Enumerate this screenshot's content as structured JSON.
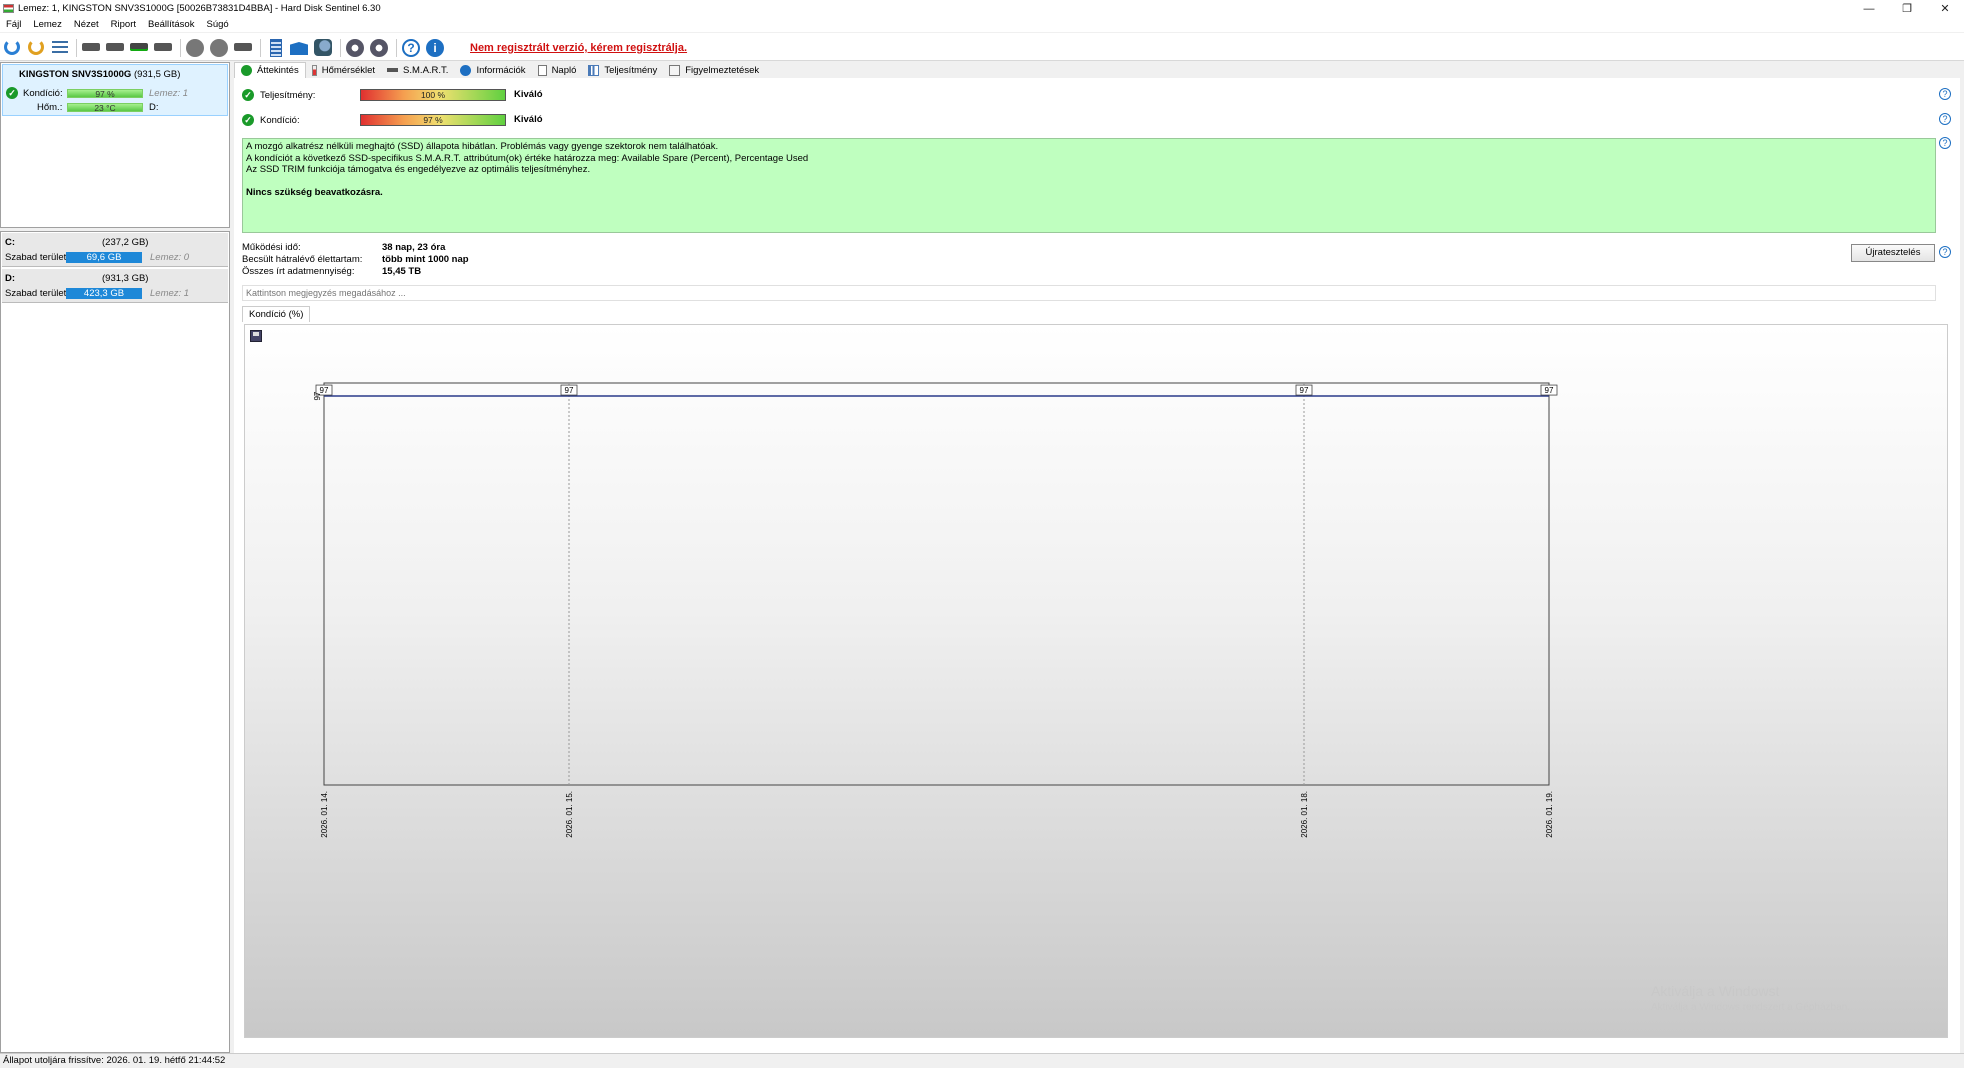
{
  "window": {
    "title": "Lemez: 1, KINGSTON SNV3S1000G [50026B73831D4BBA] - Hard Disk Sentinel 6.30",
    "minimize": "—",
    "restore": "❐",
    "close": "✕"
  },
  "menu": [
    "Fájl",
    "Lemez",
    "Nézet",
    "Riport",
    "Beállítások",
    "Súgó"
  ],
  "toolbar": {
    "register_link": "Nem regisztrált verzió, kérem regisztrálja.",
    "help_glyph": "?",
    "info_glyph": "i"
  },
  "disk_list": {
    "name": "KINGSTON SNV3S1000G",
    "capacity": "(931,5 GB)",
    "health_label": "Kondíció:",
    "health_value": "97 %",
    "health_fraction": 0.97,
    "disk_ref": "Lemez: 1",
    "temp_label": "Hőm.:",
    "temp_value": "23 °C",
    "volume_ref": "D:"
  },
  "volumes": [
    {
      "letter": "C:",
      "size": "(237,2 GB)",
      "free_label": "Szabad terület",
      "free_value": "69,6 GB",
      "disk_ref": "Lemez: 0",
      "color": "#1e88d8"
    },
    {
      "letter": "D:",
      "size": "(931,3 GB)",
      "free_label": "Szabad terület",
      "free_value": "423,3 GB",
      "disk_ref": "Lemez: 1",
      "color": "#1e88d8"
    }
  ],
  "tabs": [
    "Áttekintés",
    "Hőmérséklet",
    "S.M.A.R.T.",
    "Információk",
    "Napló",
    "Teljesítmény",
    "Figyelmeztetések"
  ],
  "overview": {
    "performance_label": "Teljesítmény:",
    "performance_value": "100 %",
    "performance_fraction": 1.0,
    "performance_rating": "Kiváló",
    "health_label": "Kondíció:",
    "health_value": "97 %",
    "health_fraction": 0.97,
    "health_rating": "Kiváló",
    "status_lines": [
      "A mozgó alkatrész nélküli meghajtó (SSD) állapota hibátlan. Problémás vagy gyenge szektorok nem találhatóak.",
      "A kondíciót a következő SSD-specifikus S.M.A.R.T. attribútum(ok) értéke határozza meg:  Available Spare (Percent), Percentage Used",
      "Az SSD TRIM funkciója támogatva és engedélyezve az optimális teljesítményhez."
    ],
    "status_conclusion": "Nincs szükség beavatkozásra.",
    "power_on_label": "Működési idő:",
    "power_on_value": "38 nap, 23 óra",
    "lifetime_label": "Becsült hátralévő élettartam:",
    "lifetime_value": "több mint 1000 nap",
    "written_label": "Összes írt adatmennyiség:",
    "written_value": "15,45 TB",
    "retest_button": "Újratesztelés",
    "note_placeholder": "Kattintson megjegyzés megadásához ..."
  },
  "chart_tab": "Kondíció  (%)",
  "chart_data": {
    "type": "line",
    "x": [
      "2026. 01. 14.",
      "2026. 01. 15.",
      "2026. 01. 18.",
      "2026. 01. 19."
    ],
    "series": [
      {
        "values": [
          97,
          97,
          97,
          97
        ]
      }
    ],
    "ytick": "97",
    "xlabel": "",
    "ylabel": "",
    "line_color": "#2a3a8a",
    "grid": true
  },
  "watermark": {
    "line1": "Aktiválja a Windowst",
    "line2": "Aktiválja a Windows rendszert a Gépházban."
  },
  "statusbar": {
    "text": "Állapot utoljára frissítve: 2026. 01. 19. hétfő 21:44:52"
  }
}
